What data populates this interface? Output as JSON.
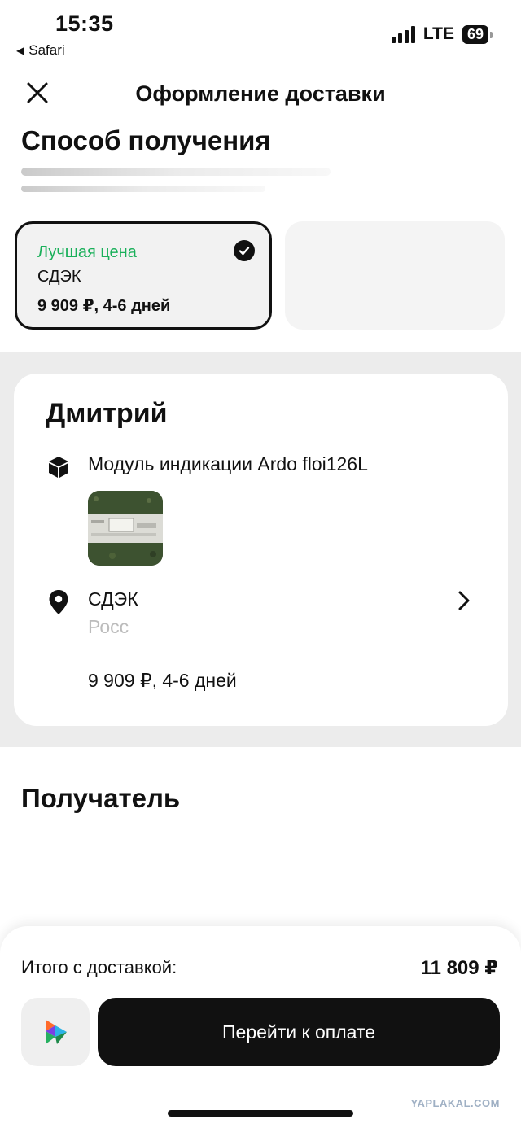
{
  "status_bar": {
    "time": "15:35",
    "back_app": "Safari",
    "network": "LTE",
    "battery": "69"
  },
  "header": {
    "title": "Оформление доставки"
  },
  "delivery_method": {
    "title": "Способ получения",
    "options": [
      {
        "badge": "Лучшая цена",
        "name": "СДЭК",
        "price": "9 909 ₽, 4-6 дней",
        "selected": true
      }
    ]
  },
  "order": {
    "seller_name": "Дмитрий",
    "product_name": "Модуль индикации Ardo floi126L",
    "pickup": {
      "name": "СДЭК",
      "address_partial": "Росс",
      "price": "9 909 ₽, 4-6 дней"
    }
  },
  "recipient": {
    "title": "Получатель"
  },
  "checkout": {
    "total_label": "Итого с доставкой:",
    "total_value": "11 809 ₽",
    "pay_button": "Перейти к оплате"
  },
  "watermark": "YAPLAKAL.COM",
  "colors": {
    "accent_green": "#1ab05a",
    "primary_dark": "#111111",
    "band_grey": "#ececec"
  }
}
